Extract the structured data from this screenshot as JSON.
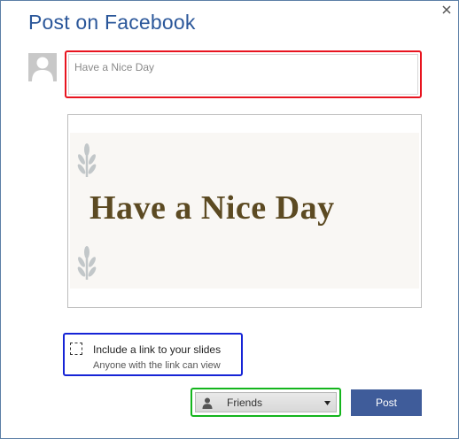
{
  "dialog": {
    "title": "Post on Facebook",
    "close_icon": "close-icon"
  },
  "composer": {
    "avatar_icon": "user-silhouette-icon",
    "placeholder": "Have a Nice Day"
  },
  "preview": {
    "slide_title": "Have a Nice Day",
    "decoration_icon": "leaf-sprig-icon",
    "colors": {
      "title": "#5c4a22",
      "background": "#f9f7f4"
    }
  },
  "link_option": {
    "checked": false,
    "label": "Include a link to your slides",
    "sublabel": "Anyone with the link can view"
  },
  "audience": {
    "icon": "person-icon",
    "selected": "Friends",
    "caret_icon": "caret-down-icon"
  },
  "post_button": {
    "label": "Post",
    "color": "#3f5c9a"
  },
  "highlight_colors": {
    "message_box": "#e8141f",
    "link_option": "#1624d6",
    "audience": "#14b51d"
  }
}
